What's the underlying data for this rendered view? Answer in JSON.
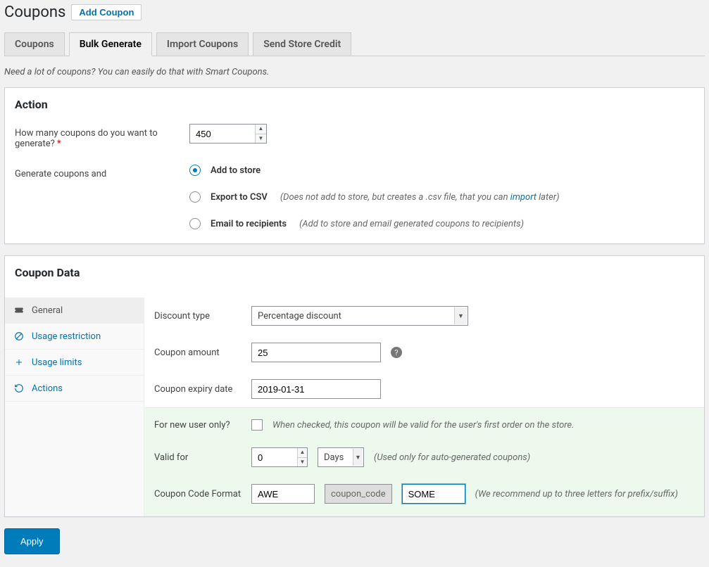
{
  "header": {
    "title": "Coupons",
    "add_button": "Add Coupon"
  },
  "tabs": {
    "items": [
      {
        "label": "Coupons"
      },
      {
        "label": "Bulk Generate"
      },
      {
        "label": "Import Coupons"
      },
      {
        "label": "Send Store Credit"
      }
    ],
    "active_index": 1
  },
  "subtitle": "Need a lot of coupons? You can easily do that with Smart Coupons.",
  "action": {
    "heading": "Action",
    "count_label": "How many coupons do you want to generate?",
    "count_value": "450",
    "mode_label": "Generate coupons and",
    "options": {
      "add": {
        "label": "Add to store"
      },
      "csv": {
        "label": "Export to CSV",
        "hint_before": "(Does not add to store, but creates a .csv file, that you can ",
        "hint_link": "import",
        "hint_after": " later)"
      },
      "email": {
        "label": "Email to recipients",
        "hint": "(Add to store and email generated coupons to recipients)"
      }
    }
  },
  "coupon_data": {
    "heading": "Coupon Data",
    "side_tabs": [
      {
        "id": "general",
        "label": "General"
      },
      {
        "id": "usage_restriction",
        "label": "Usage restriction"
      },
      {
        "id": "usage_limits",
        "label": "Usage limits"
      },
      {
        "id": "actions",
        "label": "Actions"
      }
    ],
    "discount_type": {
      "label": "Discount type",
      "value": "Percentage discount"
    },
    "amount": {
      "label": "Coupon amount",
      "value": "25"
    },
    "expiry": {
      "label": "Coupon expiry date",
      "value": "2019-01-31"
    },
    "new_user": {
      "label": "For new user only?",
      "hint": "When checked, this coupon will be valid for the user's first order on the store."
    },
    "valid_for": {
      "label": "Valid for",
      "value": "0",
      "unit": "Days",
      "hint": "(Used only for auto-generated coupons)"
    },
    "code_format": {
      "label": "Coupon Code Format",
      "prefix": "AWE",
      "mid": "coupon_code",
      "suffix": "SOME",
      "hint": "(We recommend up to three letters for prefix/suffix)"
    }
  },
  "footer": {
    "apply": "Apply"
  }
}
